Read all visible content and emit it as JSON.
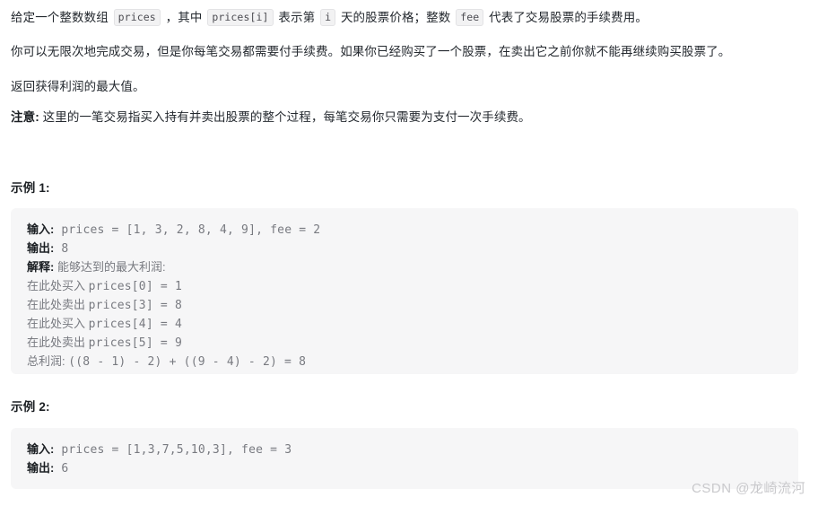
{
  "problem": {
    "intro": {
      "seg1": "给定一个整数数组 ",
      "code1": "prices",
      "seg2": " ，其中 ",
      "code2": "prices[i]",
      "seg3": " 表示第 ",
      "code3": "i",
      "seg4": " 天的股票价格；整数 ",
      "code4": "fee",
      "seg5": " 代表了交易股票的手续费用。"
    },
    "unlimited": "你可以无限次地完成交易，但是你每笔交易都需要付手续费。如果你已经购买了一个股票，在卖出它之前你就不能再继续购买股票了。",
    "return_max": "返回获得利润的最大值。",
    "note": {
      "label": "注意:",
      "text": " 这里的一笔交易指买入持有并卖出股票的整个过程，每笔交易你只需要为支付一次手续费。"
    }
  },
  "examples": [
    {
      "title": "示例 1:",
      "lines": [
        {
          "label": "输入:",
          "code": " prices = [1, 3, 2, 8, 4, 9], fee = 2"
        },
        {
          "label": "输出:",
          "code": " 8"
        },
        {
          "label": "解释:",
          "cn": " 能够达到的最大利润:"
        },
        {
          "cn": "在此处买入 ",
          "code": "prices[0] = 1"
        },
        {
          "cn": "在此处卖出 ",
          "code": "prices[3] = 8"
        },
        {
          "cn": "在此处买入 ",
          "code": "prices[4] = 4"
        },
        {
          "cn": "在此处卖出 ",
          "code": "prices[5] = 9"
        },
        {
          "cn": "总利润: ",
          "code": "((8 - 1) - 2) + ((9 - 4) - 2) = 8"
        }
      ]
    },
    {
      "title": "示例 2:",
      "lines": [
        {
          "label": "输入:",
          "code": " prices = [1,3,7,5,10,3], fee = 3"
        },
        {
          "label": "输出:",
          "code": " 6"
        }
      ]
    }
  ],
  "watermark": "CSDN @龙崎流河",
  "colors": {
    "code_block_bg": "#f6f6f7",
    "inline_code_bg": "#f2f2f3",
    "body_text": "#24292f",
    "code_text": "#787a80",
    "watermark": "#c9c9cc"
  }
}
